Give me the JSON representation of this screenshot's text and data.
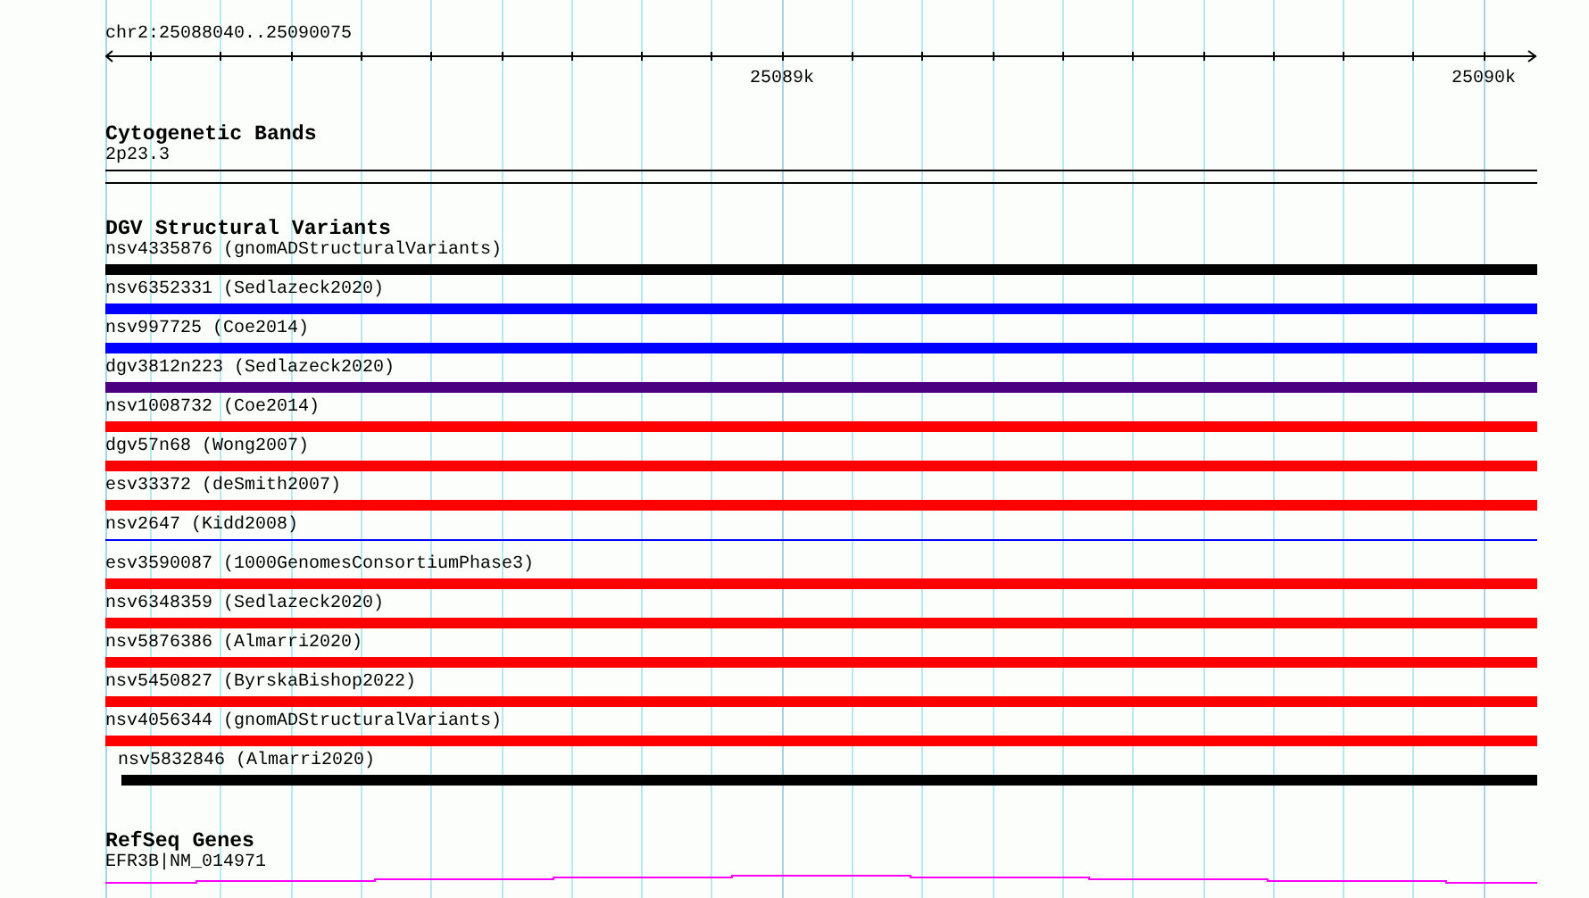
{
  "ruler": {
    "position": "chr2:25088040..25090075",
    "tick_labels": [
      "25089k",
      "25090k"
    ]
  },
  "tracks": [
    {
      "kind": "bands",
      "title": "Cytogenetic Bands",
      "label": "2p23.3"
    },
    {
      "kind": "variants",
      "title": "DGV Structural Variants",
      "items": [
        {
          "label": "nsv4335876 (gnomADStructuralVariants)",
          "color": "#000000",
          "kind": "bar"
        },
        {
          "label": "nsv6352331 (Sedlazeck2020)",
          "color": "#0000ff",
          "kind": "bar"
        },
        {
          "label": "nsv997725 (Coe2014)",
          "color": "#0000ff",
          "kind": "bar"
        },
        {
          "label": "dgv3812n223 (Sedlazeck2020)",
          "color": "#4b0082",
          "kind": "bar"
        },
        {
          "label": "nsv1008732 (Coe2014)",
          "color": "#ff0000",
          "kind": "bar"
        },
        {
          "label": "dgv57n68 (Wong2007)",
          "color": "#ff0000",
          "kind": "bar"
        },
        {
          "label": "esv33372 (deSmith2007)",
          "color": "#ff0000",
          "kind": "bar"
        },
        {
          "label": "nsv2647 (Kidd2008)",
          "color": "#0000ff",
          "kind": "line"
        },
        {
          "label": "esv3590087 (1000GenomesConsortiumPhase3)",
          "color": "#ff0000",
          "kind": "bar"
        },
        {
          "label": "nsv6348359 (Sedlazeck2020)",
          "color": "#ff0000",
          "kind": "bar"
        },
        {
          "label": "nsv5876386 (Almarri2020)",
          "color": "#ff0000",
          "kind": "bar"
        },
        {
          "label": "nsv5450827 (ByrskaBishop2022)",
          "color": "#ff0000",
          "kind": "bar"
        },
        {
          "label": "nsv4056344 (gnomADStructuralVariants)",
          "color": "#ff0000",
          "kind": "bar"
        },
        {
          "label": "nsv5832846 (Almarri2020)",
          "color": "#000000",
          "kind": "inset"
        }
      ]
    },
    {
      "kind": "genes",
      "title": "RefSeq Genes",
      "label": "EFR3B|NM_014971"
    }
  ]
}
